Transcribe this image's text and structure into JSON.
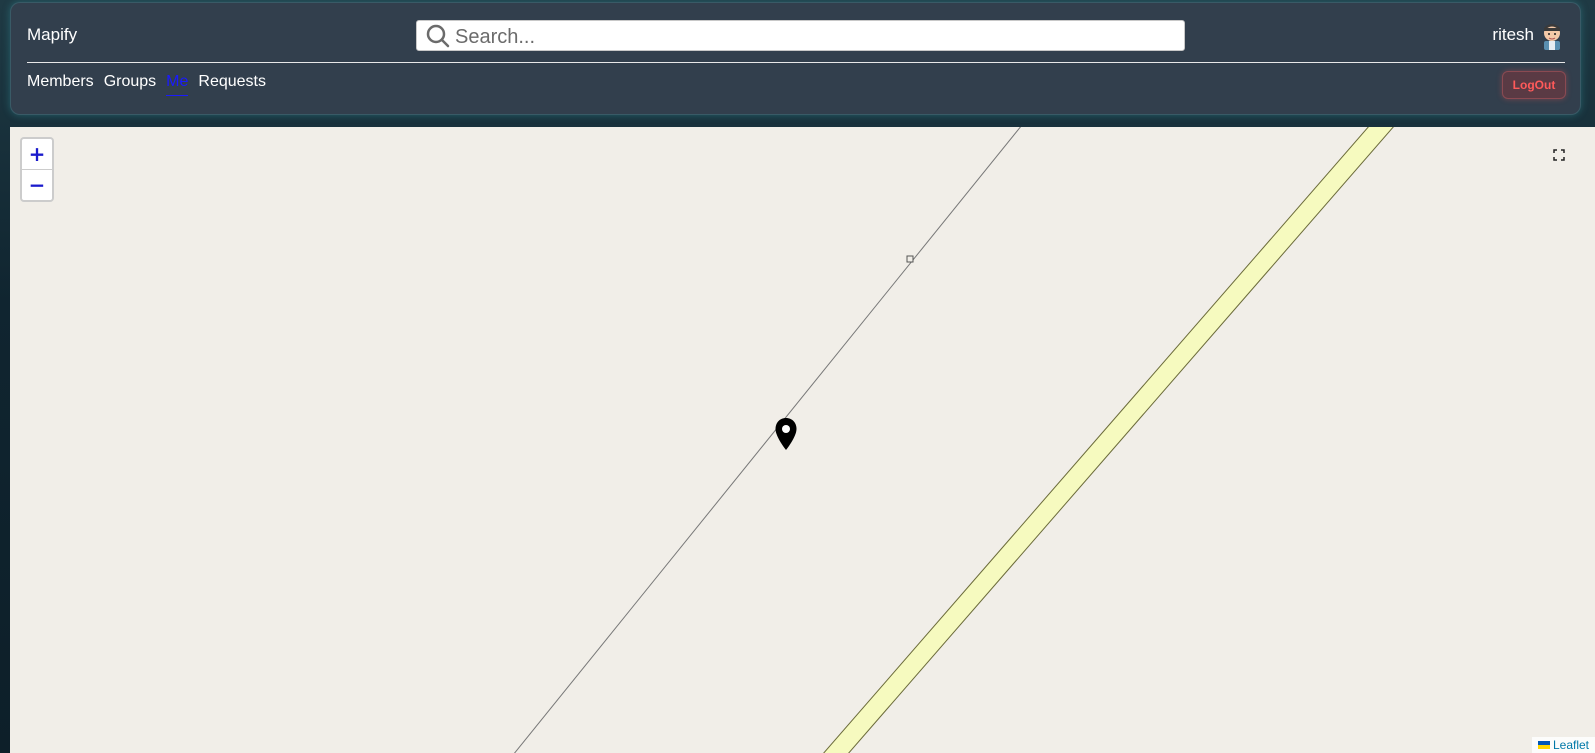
{
  "header": {
    "brand": "Mapify",
    "search": {
      "placeholder": "Search...",
      "value": ""
    },
    "user": {
      "name": "ritesh",
      "avatar_icon": "user-avatar-icon"
    },
    "nav": [
      {
        "label": "Members",
        "active": false
      },
      {
        "label": "Groups",
        "active": false
      },
      {
        "label": "Me",
        "active": true
      },
      {
        "label": "Requests",
        "active": false
      }
    ],
    "logout_label": "LogOut"
  },
  "map": {
    "zoom_in_label": "+",
    "zoom_out_label": "−",
    "fullscreen_icon": "fullscreen-icon",
    "marker_icon": "map-pin-icon",
    "attribution": {
      "label": "Leaflet"
    }
  },
  "colors": {
    "navbar_bg": "#323f4d",
    "active_link": "#1a1aff",
    "logout_text": "#ff5a5a",
    "map_bg": "#f1eee8",
    "road_fill": "#f6fabf"
  }
}
